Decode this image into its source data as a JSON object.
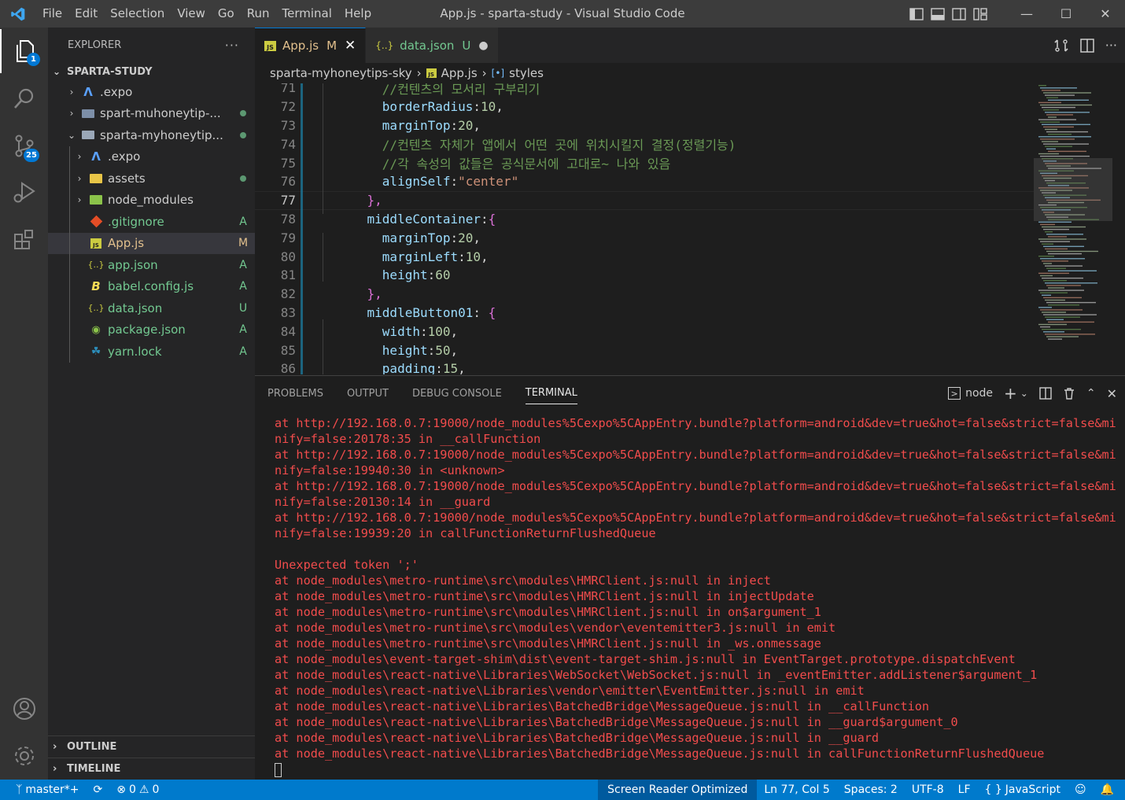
{
  "titlebar": {
    "menu": [
      "File",
      "Edit",
      "Selection",
      "View",
      "Go",
      "Run",
      "Terminal",
      "Help"
    ],
    "title": "App.js - sparta-study - Visual Studio Code"
  },
  "activitybar": {
    "explorer_badge": "1",
    "scm_badge": "25"
  },
  "sidebar": {
    "header": "EXPLORER",
    "more": "···",
    "root": "SPARTA-STUDY",
    "items": [
      {
        "label": ".expo",
        "status": ""
      },
      {
        "label": "spart-muhoneytip-...",
        "status": "dot"
      },
      {
        "label": "sparta-myhoneytip...",
        "status": "dot"
      },
      {
        "label": ".expo",
        "status": ""
      },
      {
        "label": "assets",
        "status": "dot"
      },
      {
        "label": "node_modules",
        "status": ""
      },
      {
        "label": ".gitignore",
        "status": "A"
      },
      {
        "label": "App.js",
        "status": "M"
      },
      {
        "label": "app.json",
        "status": "A"
      },
      {
        "label": "babel.config.js",
        "status": "A"
      },
      {
        "label": "data.json",
        "status": "U"
      },
      {
        "label": "package.json",
        "status": "A"
      },
      {
        "label": "yarn.lock",
        "status": "A"
      }
    ],
    "outline": "OUTLINE",
    "timeline": "TIMELINE"
  },
  "tabs": [
    {
      "label": "App.js",
      "status": "M",
      "active": true
    },
    {
      "label": "data.json",
      "status": "U",
      "active": false
    }
  ],
  "breadcrumb": {
    "folder": "sparta-myhoneytips-sky",
    "file": "App.js",
    "symbol": "styles"
  },
  "editor": {
    "lines": [
      {
        "n": "71",
        "html": "//컨텐츠의 모서리 구부리기",
        "type": "comment"
      },
      {
        "n": "72",
        "type": "prop",
        "key": "borderRadius",
        "val": "10",
        "valtype": "num",
        "tail": ","
      },
      {
        "n": "73",
        "type": "prop",
        "key": "marginTop",
        "val": "20",
        "valtype": "num",
        "tail": ","
      },
      {
        "n": "74",
        "type": "comment",
        "html": "//컨텐츠 자체가 앱에서 어떤 곳에 위치시킬지 결정(정렬기능)"
      },
      {
        "n": "75",
        "type": "comment",
        "html": "//각 속성의 값들은 공식문서에 고대로~ 나와 있음"
      },
      {
        "n": "76",
        "type": "prop",
        "key": "alignSelf",
        "val": "\"center\"",
        "valtype": "str",
        "tail": ""
      },
      {
        "n": "77",
        "type": "close",
        "text": "},"
      },
      {
        "n": "78",
        "type": "open",
        "key": "middleContainer",
        "sep": ":",
        "brace": "{"
      },
      {
        "n": "79",
        "type": "prop",
        "key": "marginTop",
        "val": "20",
        "valtype": "num",
        "tail": ","
      },
      {
        "n": "80",
        "type": "prop",
        "key": "marginLeft",
        "val": "10",
        "valtype": "num",
        "tail": ","
      },
      {
        "n": "81",
        "type": "prop",
        "key": "height",
        "val": "60",
        "valtype": "num",
        "tail": ""
      },
      {
        "n": "82",
        "type": "close",
        "text": "},"
      },
      {
        "n": "83",
        "type": "open",
        "key": "middleButton01",
        "sep": ": ",
        "brace": "{"
      },
      {
        "n": "84",
        "type": "prop",
        "key": "width",
        "val": "100",
        "valtype": "num",
        "tail": ","
      },
      {
        "n": "85",
        "type": "prop",
        "key": "height",
        "val": "50",
        "valtype": "num",
        "tail": ","
      },
      {
        "n": "86",
        "type": "prop",
        "key": "padding",
        "val": "15",
        "valtype": "num",
        "tail": ","
      }
    ]
  },
  "panel": {
    "tabs": [
      "PROBLEMS",
      "OUTPUT",
      "DEBUG CONSOLE",
      "TERMINAL"
    ],
    "shell": "node",
    "terminal": [
      "at http://192.168.0.7:19000/node_modules%5Cexpo%5CAppEntry.bundle?platform=android&dev=true&hot=false&strict=false&mi",
      "nify=false:20178:35 in __callFunction",
      "at http://192.168.0.7:19000/node_modules%5Cexpo%5CAppEntry.bundle?platform=android&dev=true&hot=false&strict=false&mi",
      "nify=false:19940:30 in <unknown>",
      "at http://192.168.0.7:19000/node_modules%5Cexpo%5CAppEntry.bundle?platform=android&dev=true&hot=false&strict=false&mi",
      "nify=false:20130:14 in __guard",
      "at http://192.168.0.7:19000/node_modules%5Cexpo%5CAppEntry.bundle?platform=android&dev=true&hot=false&strict=false&mi",
      "nify=false:19939:20 in callFunctionReturnFlushedQueue",
      "",
      "Unexpected token ';'",
      "at node_modules\\metro-runtime\\src\\modules\\HMRClient.js:null in inject",
      "at node_modules\\metro-runtime\\src\\modules\\HMRClient.js:null in injectUpdate",
      "at node_modules\\metro-runtime\\src\\modules\\HMRClient.js:null in on$argument_1",
      "at node_modules\\metro-runtime\\src\\modules\\vendor\\eventemitter3.js:null in emit",
      "at node_modules\\metro-runtime\\src\\modules\\HMRClient.js:null in _ws.onmessage",
      "at node_modules\\event-target-shim\\dist\\event-target-shim.js:null in EventTarget.prototype.dispatchEvent",
      "at node_modules\\react-native\\Libraries\\WebSocket\\WebSocket.js:null in _eventEmitter.addListener$argument_1",
      "at node_modules\\react-native\\Libraries\\vendor\\emitter\\EventEmitter.js:null in emit",
      "at node_modules\\react-native\\Libraries\\BatchedBridge\\MessageQueue.js:null in __callFunction",
      "at node_modules\\react-native\\Libraries\\BatchedBridge\\MessageQueue.js:null in __guard$argument_0",
      "at node_modules\\react-native\\Libraries\\BatchedBridge\\MessageQueue.js:null in __guard",
      "at node_modules\\react-native\\Libraries\\BatchedBridge\\MessageQueue.js:null in callFunctionReturnFlushedQueue"
    ]
  },
  "statusbar": {
    "branch": "master*+",
    "errors": "0",
    "warnings": "0",
    "screen_reader": "Screen Reader Optimized",
    "position": "Ln 77, Col 5",
    "spaces": "Spaces: 2",
    "encoding": "UTF-8",
    "eol": "LF",
    "language": "JavaScript"
  },
  "colors": {
    "accent": "#007acc",
    "error_text": "#f14c4c",
    "git_added": "#73c991",
    "git_modified": "#e2c08d"
  }
}
